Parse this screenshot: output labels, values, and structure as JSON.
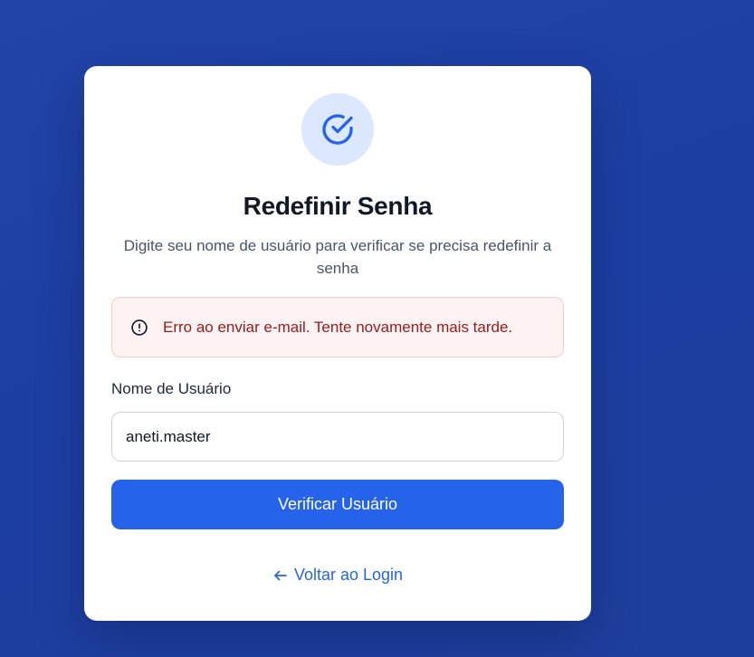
{
  "colors": {
    "accent": "#2563eb",
    "icon_circle_bg": "#dbe8fd",
    "error_text": "#991b1b",
    "error_bg": "#fef2f2",
    "error_border": "#fecaca"
  },
  "icons": {
    "header": "check-circle-icon",
    "alert": "alert-circle-icon",
    "back": "arrow-left-icon"
  },
  "header": {
    "title": "Redefinir Senha",
    "subtitle": "Digite seu nome de usuário para verificar se precisa redefinir a senha"
  },
  "alert": {
    "message": "Erro ao enviar e-mail. Tente novamente mais tarde."
  },
  "form": {
    "username_label": "Nome de Usuário",
    "username_value": "aneti.master",
    "submit_label": "Verificar Usuário"
  },
  "footer": {
    "back_label": "Voltar ao Login"
  }
}
